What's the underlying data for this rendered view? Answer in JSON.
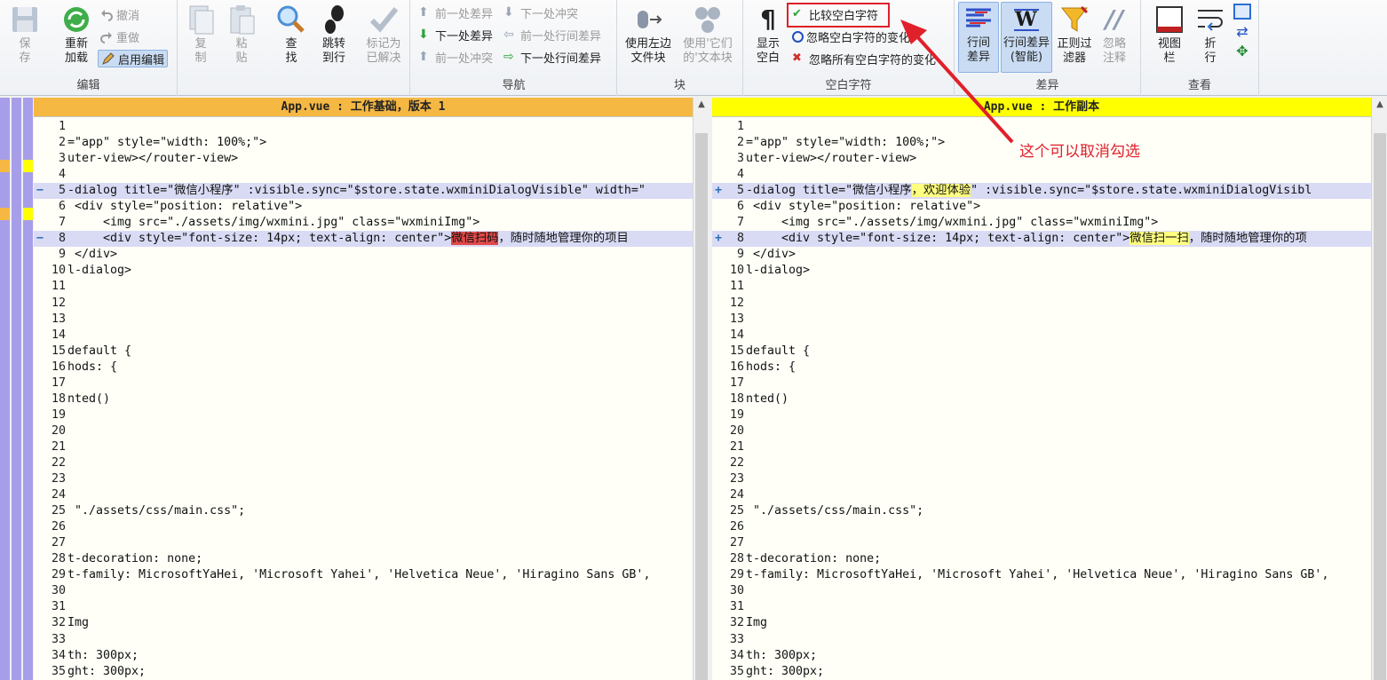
{
  "ribbon": {
    "save": "保存",
    "reload": "重新加载",
    "undo": "撤消",
    "redo": "重做",
    "enable_edit": "启用编辑",
    "copy": "复制",
    "paste": "粘贴",
    "find": "查找",
    "goto_line": "跳转到行",
    "mark_resolved": "标记为已解决",
    "edit_group": "编辑",
    "prev_diff": "前一处差异",
    "next_conflict": "下一处冲突",
    "next_diff": "下一处差异",
    "prev_line_diff": "前一处行间差异",
    "prev_conflict": "前一处冲突",
    "next_line_diff": "下一处行间差异",
    "nav_group": "导航",
    "use_left_block": "使用左边文件块",
    "use_other_block": "使用'它们的'文本块",
    "block_group": "块",
    "show_whitespace": "显示空白",
    "compare_whitespace": "比较空白字符",
    "ignore_ws_change": "忽略空白字符的变化",
    "ignore_all_ws": "忽略所有空白字符的变化",
    "ws_group": "空白字符",
    "line_diff": "行间差异",
    "line_diff_smart": "行间差异(智能)",
    "regex_filter": "正则过滤器",
    "ignore_comments": "忽略注释",
    "diff_group": "差异",
    "view_bar": "视图栏",
    "wrap": "折行",
    "view_group": "查看"
  },
  "left_pane": {
    "title": "App.vue : 工作基础，版本 1",
    "lines": [
      {
        "n": "1",
        "t": ""
      },
      {
        "n": "2",
        "t": "=\"app\" style=\"width: 100%;\">"
      },
      {
        "n": "3",
        "t": "uter-view></router-view>"
      },
      {
        "n": "4",
        "t": ""
      },
      {
        "n": "5",
        "t": "-dialog title=\"微信小程序\" :visible.sync=\"$store.state.wxminiDialogVisible\" width=\"",
        "mod": true,
        "mark": "−"
      },
      {
        "n": "6",
        "t": " <div style=\"position: relative\">"
      },
      {
        "n": "7",
        "t": "     <img src=\"./assets/img/wxmini.jpg\" class=\"wxminiImg\">"
      },
      {
        "n": "8",
        "t": "     <div style=\"font-size: 14px; text-align: center\">",
        "hl": "微信扫码",
        "rest": "，随时随地管理你的项目",
        "mod": true,
        "mark": "−"
      },
      {
        "n": "9",
        "t": " </div>"
      },
      {
        "n": "10",
        "t": "l-dialog>"
      },
      {
        "n": "11",
        "t": ""
      },
      {
        "n": "12",
        "t": ""
      },
      {
        "n": "13",
        "t": ""
      },
      {
        "n": "14",
        "t": ""
      },
      {
        "n": "15",
        "t": "default {"
      },
      {
        "n": "16",
        "t": "hods: {"
      },
      {
        "n": "17",
        "t": ""
      },
      {
        "n": "18",
        "t": "nted()"
      },
      {
        "n": "19",
        "t": ""
      },
      {
        "n": "20",
        "t": ""
      },
      {
        "n": "21",
        "t": ""
      },
      {
        "n": "22",
        "t": ""
      },
      {
        "n": "23",
        "t": ""
      },
      {
        "n": "24",
        "t": ""
      },
      {
        "n": "25",
        "t": " \"./assets/css/main.css\";"
      },
      {
        "n": "26",
        "t": ""
      },
      {
        "n": "27",
        "t": ""
      },
      {
        "n": "28",
        "t": "t-decoration: none;"
      },
      {
        "n": "29",
        "t": "t-family: MicrosoftYaHei, 'Microsoft Yahei', 'Helvetica Neue', 'Hiragino Sans GB',"
      },
      {
        "n": "30",
        "t": ""
      },
      {
        "n": "31",
        "t": ""
      },
      {
        "n": "32",
        "t": "Img"
      },
      {
        "n": "33",
        "t": ""
      },
      {
        "n": "34",
        "t": "th: 300px;"
      },
      {
        "n": "35",
        "t": "ght: 300px;"
      }
    ]
  },
  "right_pane": {
    "title": "App.vue : 工作副本",
    "lines": [
      {
        "n": "1",
        "t": ""
      },
      {
        "n": "2",
        "t": "=\"app\" style=\"width: 100%;\">"
      },
      {
        "n": "3",
        "t": "uter-view></router-view>"
      },
      {
        "n": "4",
        "t": ""
      },
      {
        "n": "5",
        "t": "-dialog title=\"微信小程序",
        "hl": "，欢迎体验",
        "rest": "\" :visible.sync=\"$store.state.wxminiDialogVisibl",
        "mod": true,
        "mark": "+"
      },
      {
        "n": "6",
        "t": " <div style=\"position: relative\">"
      },
      {
        "n": "7",
        "t": "     <img src=\"./assets/img/wxmini.jpg\" class=\"wxminiImg\">"
      },
      {
        "n": "8",
        "t": "     <div style=\"font-size: 14px; text-align: center\">",
        "hl": "微信扫一扫",
        "rest": "，随时随地管理你的项",
        "mod": true,
        "mark": "+"
      },
      {
        "n": "9",
        "t": " </div>"
      },
      {
        "n": "10",
        "t": "l-dialog>"
      },
      {
        "n": "11",
        "t": ""
      },
      {
        "n": "12",
        "t": ""
      },
      {
        "n": "13",
        "t": ""
      },
      {
        "n": "14",
        "t": ""
      },
      {
        "n": "15",
        "t": "default {"
      },
      {
        "n": "16",
        "t": "hods: {"
      },
      {
        "n": "17",
        "t": ""
      },
      {
        "n": "18",
        "t": "nted()"
      },
      {
        "n": "19",
        "t": ""
      },
      {
        "n": "20",
        "t": ""
      },
      {
        "n": "21",
        "t": ""
      },
      {
        "n": "22",
        "t": ""
      },
      {
        "n": "23",
        "t": ""
      },
      {
        "n": "24",
        "t": ""
      },
      {
        "n": "25",
        "t": " \"./assets/css/main.css\";"
      },
      {
        "n": "26",
        "t": ""
      },
      {
        "n": "27",
        "t": ""
      },
      {
        "n": "28",
        "t": "t-decoration: none;"
      },
      {
        "n": "29",
        "t": "t-family: MicrosoftYaHei, 'Microsoft Yahei', 'Helvetica Neue', 'Hiragino Sans GB',"
      },
      {
        "n": "30",
        "t": ""
      },
      {
        "n": "31",
        "t": ""
      },
      {
        "n": "32",
        "t": "Img"
      },
      {
        "n": "33",
        "t": ""
      },
      {
        "n": "34",
        "t": "th: 300px;"
      },
      {
        "n": "35",
        "t": "ght: 300px;"
      }
    ]
  },
  "annotation": {
    "text": "这个可以取消勾选",
    "color": "#e0202a"
  },
  "colors": {
    "left_header": "#f5b843",
    "right_header": "#ffff00",
    "modified_line": "#d9dbf5",
    "removed_highlight": "#e04a4a",
    "added_highlight": "#ffff80",
    "margin_strip": "#a79eea"
  }
}
